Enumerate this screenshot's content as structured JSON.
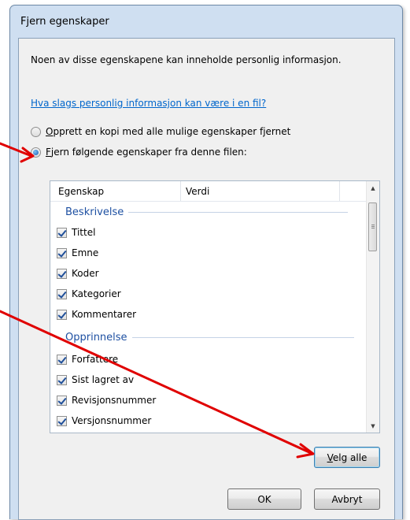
{
  "dialog": {
    "title": "Fjern egenskaper",
    "description": "Noen av disse egenskapene kan inneholde personlig informasjon.",
    "help_link": "Hva slags personlig informasjon kan være i en fil?",
    "radio_copy": {
      "mnemonic": "O",
      "rest": "pprett en kopi med alle mulige egenskaper fjernet",
      "checked": false
    },
    "radio_remove": {
      "mnemonic": "F",
      "rest": "jern følgende egenskaper fra denne filen:",
      "checked": true
    }
  },
  "list": {
    "columns": [
      "Egenskap",
      "Verdi"
    ],
    "groups": [
      {
        "name": "Beskrivelse",
        "items": [
          "Tittel",
          "Emne",
          "Koder",
          "Kategorier",
          "Kommentarer"
        ]
      },
      {
        "name": "Opprinnelse",
        "items": [
          "Forfattere",
          "Sist lagret av",
          "Revisjonsnummer",
          "Versjonsnummer"
        ]
      }
    ],
    "scroll_up_icon": "triangle-up",
    "scroll_down_icon": "triangle-down"
  },
  "buttons": {
    "select_all": {
      "mnemonic": "V",
      "rest": "elg alle"
    },
    "ok": "OK",
    "cancel": "Avbryt"
  },
  "colors": {
    "annotation_arrow": "#e00000",
    "link": "#0066cc",
    "group_header": "#1e50a2"
  }
}
